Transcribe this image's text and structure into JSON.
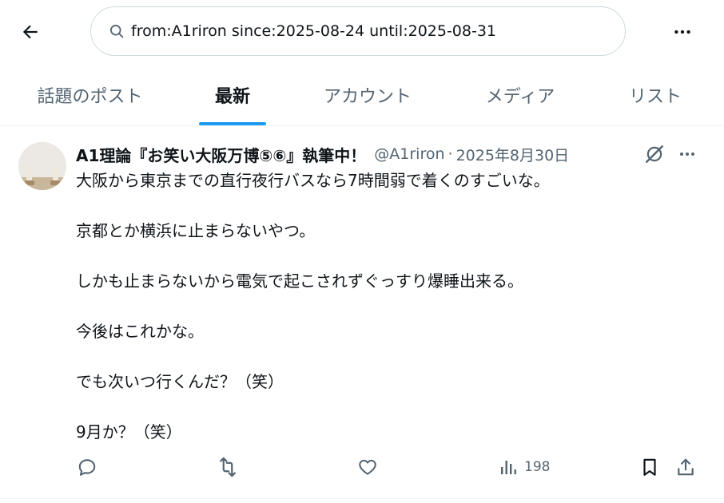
{
  "search": {
    "query": "from:A1riron since:2025-08-24 until:2025-08-31"
  },
  "tabs": [
    {
      "label": "話題のポスト"
    },
    {
      "label": "最新"
    },
    {
      "label": "アカウント"
    },
    {
      "label": "メディア"
    },
    {
      "label": "リスト"
    }
  ],
  "active_tab": "最新",
  "accent_color": "#1d9bf0",
  "post": {
    "display_name": "A1理論『お笑い大阪万博⑤⑥』執筆中！",
    "handle": "@A1riron",
    "separator": "·",
    "timestamp": "2025年8月30日",
    "lines": [
      "大阪から東京までの直行夜行バスなら7時間弱で着くのすごいな。",
      "京都とか横浜に止まらないやつ。",
      "しかも止まらないから電気で起こされずぐっすり爆睡出来る。",
      "今後はこれかな。",
      "でも次いつ行くんだ？（笑）",
      "9月か？（笑）"
    ],
    "views": "198"
  },
  "icons": {
    "back": "arrow-left-icon",
    "search": "search-icon",
    "more": "more-horizontal-icon",
    "grok": "grok-icon",
    "reply": "reply-icon",
    "repost": "repost-icon",
    "like": "heart-icon",
    "views": "analytics-icon",
    "bookmark": "bookmark-icon",
    "share": "share-icon"
  }
}
